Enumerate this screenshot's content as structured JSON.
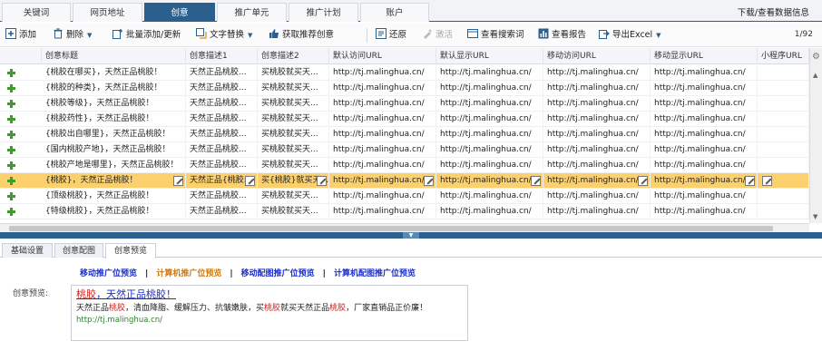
{
  "top_tabs": [
    "关键词",
    "网页地址",
    "创意",
    "推广单元",
    "推广计划",
    "账户"
  ],
  "active_tab_index": 2,
  "download_link": "下载/查看数据信息",
  "toolbar": {
    "add": "添加",
    "delete": "删除",
    "batch_add": "批量添加/更新",
    "text_replace": "文字替换",
    "get_recommended": "获取推荐创意",
    "restore": "还原",
    "activate": "激活",
    "view_search_terms": "查看搜索词",
    "view_report": "查看报告",
    "export_excel": "导出Excel",
    "pager": "1/92"
  },
  "grid": {
    "headers": [
      "创意标题",
      "创意描述1",
      "创意描述2",
      "默认访问URL",
      "默认显示URL",
      "移动访问URL",
      "移动显示URL",
      "小程序URL"
    ],
    "rows": [
      {
        "title": "{桃胶在哪买}，天然正品桃胶！",
        "desc1": "天然正品桃胶...",
        "desc2": "买桃胶就买天...",
        "url1": "http://tj.malinghua.cn/",
        "url2": "http://tj.malinghua.cn/",
        "url3": "http://tj.malinghua.cn/",
        "url4": "http://tj.malinghua.cn/"
      },
      {
        "title": "{桃胶的种类}，天然正品桃胶！",
        "desc1": "天然正品桃胶...",
        "desc2": "买桃胶就买天...",
        "url1": "http://tj.malinghua.cn/",
        "url2": "http://tj.malinghua.cn/",
        "url3": "http://tj.malinghua.cn/",
        "url4": "http://tj.malinghua.cn/"
      },
      {
        "title": "{桃胶等级}，天然正品桃胶！",
        "desc1": "天然正品桃胶...",
        "desc2": "买桃胶就买天...",
        "url1": "http://tj.malinghua.cn/",
        "url2": "http://tj.malinghua.cn/",
        "url3": "http://tj.malinghua.cn/",
        "url4": "http://tj.malinghua.cn/"
      },
      {
        "title": "{桃胶药性}，天然正品桃胶！",
        "desc1": "天然正品桃胶...",
        "desc2": "买桃胶就买天...",
        "url1": "http://tj.malinghua.cn/",
        "url2": "http://tj.malinghua.cn/",
        "url3": "http://tj.malinghua.cn/",
        "url4": "http://tj.malinghua.cn/"
      },
      {
        "title": "{桃胶出自哪里}，天然正品桃胶！",
        "desc1": "天然正品桃胶...",
        "desc2": "买桃胶就买天...",
        "url1": "http://tj.malinghua.cn/",
        "url2": "http://tj.malinghua.cn/",
        "url3": "http://tj.malinghua.cn/",
        "url4": "http://tj.malinghua.cn/"
      },
      {
        "title": "{国内桃胶产地}，天然正品桃胶！",
        "desc1": "天然正品桃胶...",
        "desc2": "买桃胶就买天...",
        "url1": "http://tj.malinghua.cn/",
        "url2": "http://tj.malinghua.cn/",
        "url3": "http://tj.malinghua.cn/",
        "url4": "http://tj.malinghua.cn/"
      },
      {
        "title": "{桃胶产地是哪里}，天然正品桃胶！",
        "desc1": "天然正品桃胶...",
        "desc2": "买桃胶就买天...",
        "url1": "http://tj.malinghua.cn/",
        "url2": "http://tj.malinghua.cn/",
        "url3": "http://tj.malinghua.cn/",
        "url4": "http://tj.malinghua.cn/"
      },
      {
        "title": "{桃胶}，天然正品桃胶！",
        "desc1": "天然正品{桃胶...",
        "desc2": "买{桃胶}就买天...",
        "url1": "http://tj.malinghua.cn/",
        "url2": "http://tj.malinghua.cn/",
        "url3": "http://tj.malinghua.cn/",
        "url4": "http://tj.malinghua.cn/"
      },
      {
        "title": "{顶级桃胶}，天然正品桃胶！",
        "desc1": "天然正品桃胶...",
        "desc2": "买桃胶就买天...",
        "url1": "http://tj.malinghua.cn/",
        "url2": "http://tj.malinghua.cn/",
        "url3": "http://tj.malinghua.cn/",
        "url4": "http://tj.malinghua.cn/"
      },
      {
        "title": "{特级桃胶}，天然正品桃胶！",
        "desc1": "天然正品桃胶...",
        "desc2": "买桃胶就买天...",
        "url1": "http://tj.malinghua.cn/",
        "url2": "http://tj.malinghua.cn/",
        "url3": "http://tj.malinghua.cn/",
        "url4": "http://tj.malinghua.cn/"
      }
    ],
    "selected_row_index": 7
  },
  "bottom_tabs": [
    "基础设置",
    "创意配图",
    "创意预览"
  ],
  "active_bottom_tab_index": 2,
  "preview_links": [
    "移动推广位预览",
    "计算机推广位预览",
    "移动配图推广位预览",
    "计算机配图推广位预览"
  ],
  "preview": {
    "label": "创意预览:",
    "title_kw": "桃胶",
    "title_rest": "，天然正品桃胶！",
    "desc_1": "天然正品",
    "desc_kw1": "桃胶",
    "desc_2": "，清血降脂、缓解压力、抗皱嫩肤，买",
    "desc_kw2": "桃胶",
    "desc_3": "就买天然正品",
    "desc_kw3": "桃胶",
    "desc_4": "，厂家直销品正价廉！",
    "url": "http://tj.malinghua.cn/"
  },
  "colors": {
    "header_blue": "#2b5f8d",
    "selected_row": "#fbd06d",
    "link_blue": "#1b2fc8",
    "link_orange": "#d07a12",
    "keyword_red": "#d0211c"
  }
}
